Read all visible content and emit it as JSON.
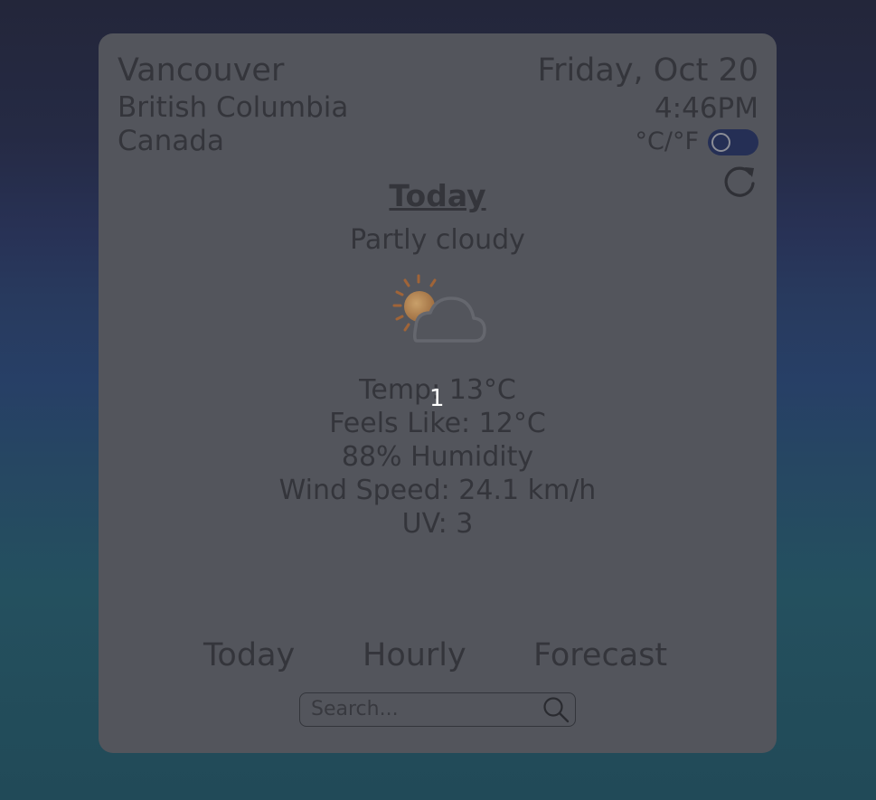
{
  "location": {
    "city": "Vancouver",
    "region": "British Columbia",
    "country": "Canada"
  },
  "datetime": {
    "date": "Friday, Oct 20",
    "time": "4:46PM"
  },
  "units": {
    "label": "°C/°F",
    "toggle_color": "#252f55"
  },
  "today": {
    "heading": "Today",
    "condition": "Partly cloudy",
    "icon": "partly-cloudy-icon",
    "temp": "Temp: 13°C",
    "feels_like": "Feels Like: 12°C",
    "humidity": "88% Humidity",
    "wind": "Wind Speed: 24.1 km/h",
    "uv": "UV: 3"
  },
  "marker": "1",
  "tabs": [
    "Today",
    "Hourly",
    "Forecast"
  ],
  "search": {
    "placeholder": "Search..."
  },
  "colors": {
    "card": "#53555c",
    "text": "#34353b"
  }
}
